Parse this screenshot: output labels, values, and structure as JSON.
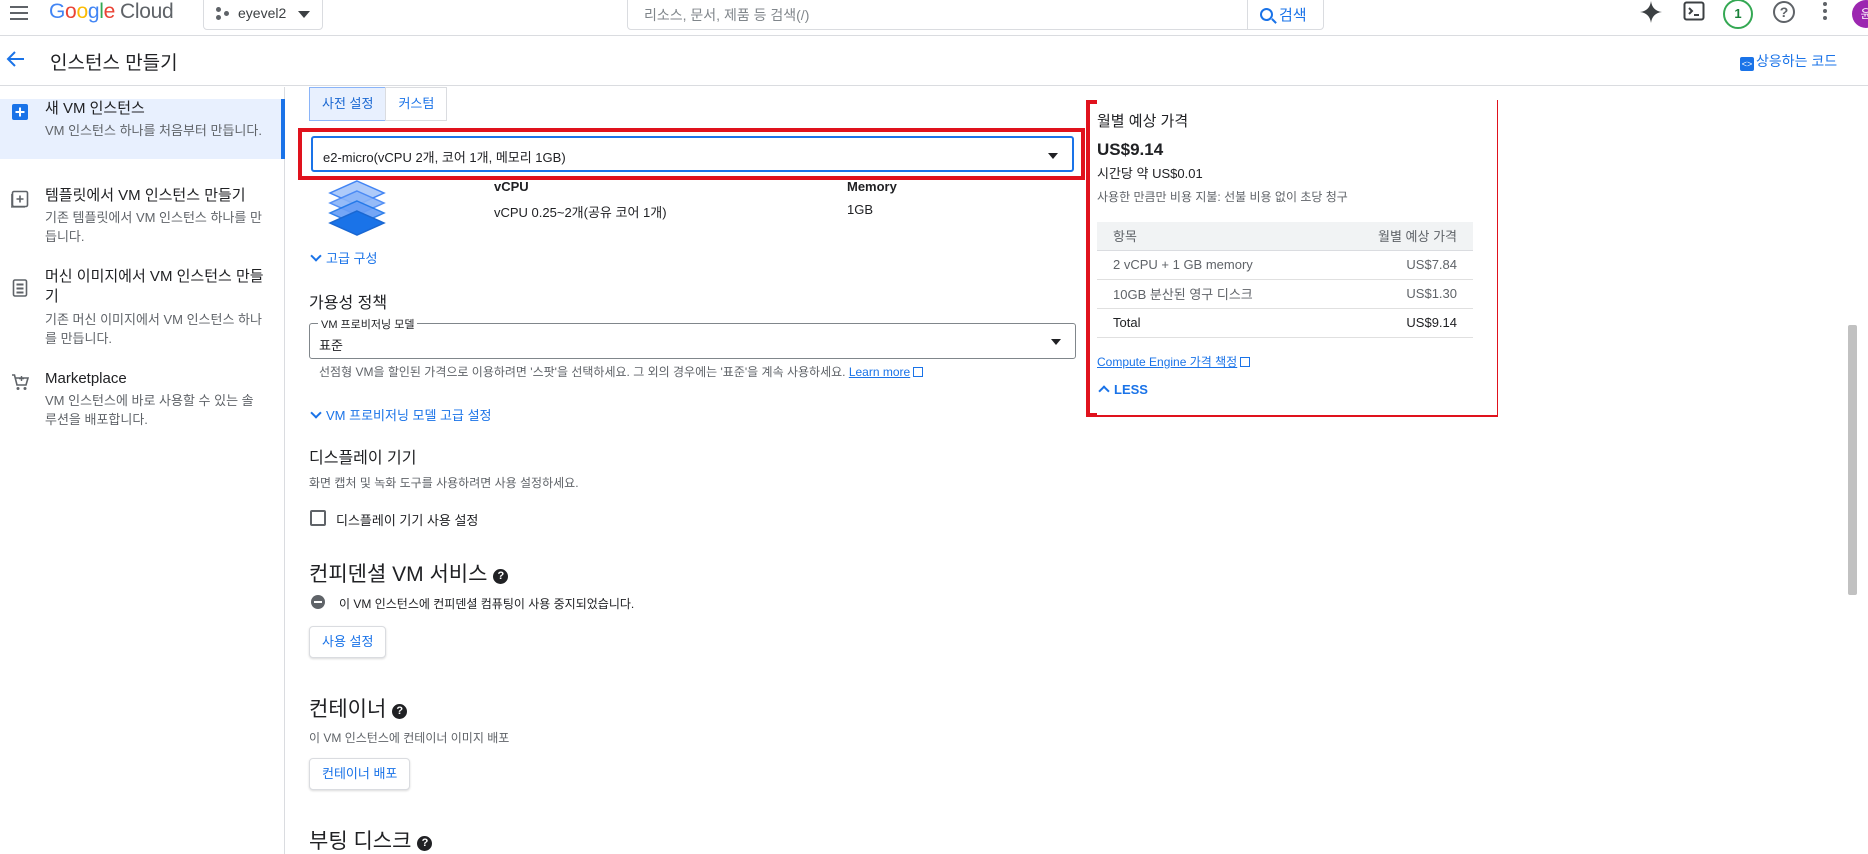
{
  "topbar": {
    "logo": {
      "g": "G",
      "o1": "o",
      "o2": "o",
      "g2": "g",
      "l": "l",
      "e": "e",
      "cloud": "Cloud"
    },
    "project": "eyevel2",
    "search_placeholder": "리소스, 문서, 제품 등 검색(/)",
    "search_button": "검색",
    "notification_count": "1",
    "avatar_initial": "윤"
  },
  "header": {
    "title": "인스턴스 만들기",
    "code_link": "상응하는 코드"
  },
  "sidebar": {
    "items": [
      {
        "label": "새 VM 인스턴스",
        "desc": "VM 인스턴스 하나를 처음부터 만듭니다."
      },
      {
        "label": "템플릿에서 VM 인스턴스 만들기",
        "desc": "기존 템플릿에서 VM 인스턴스 하나를 만듭니다."
      },
      {
        "label": "머신 이미지에서 VM 인스턴스 만들기",
        "desc": "기존 머신 이미지에서 VM 인스턴스 하나를 만듭니다."
      },
      {
        "label": "Marketplace",
        "desc": "VM 인스턴스에 바로 사용할 수 있는 솔루션을 배포합니다."
      }
    ]
  },
  "main": {
    "tabs": [
      "사전 설정",
      "커스텀"
    ],
    "machine_type": "e2-micro(vCPU 2개, 코어 1개, 메모리 1GB)",
    "specs": {
      "vcpu_header": "vCPU",
      "vcpu_value": "vCPU 0.25~2개(공유 코어 1개)",
      "memory_header": "Memory",
      "memory_value": "1GB"
    },
    "advanced_config": "고급 구성",
    "availability": {
      "title": "가용성 정책",
      "field_label": "VM 프로비저닝 모델",
      "field_value": "표준",
      "hint": "선점형 VM을 할인된 가격으로 이용하려면 '스팟'을 선택하세요. 그 외의 경우에는 '표준'을 계속 사용하세요.",
      "learn_more": "Learn more",
      "advanced_link": "VM 프로비저닝 모델 고급 설정"
    },
    "display": {
      "title": "디스플레이 기기",
      "hint": "화면 캡처 및 녹화 도구를 사용하려면 사용 설정하세요.",
      "checkbox_label": "디스플레이 기기 사용 설정"
    },
    "confidential": {
      "title": "컨피덴셜 VM 서비스",
      "status": "이 VM 인스턴스에 컨피덴셜 컴퓨팅이 사용 중지되었습니다.",
      "button": "사용 설정"
    },
    "container": {
      "title": "컨테이너",
      "hint": "이 VM 인스턴스에 컨테이너 이미지 배포",
      "button": "컨테이너 배포"
    },
    "boot_disk": {
      "title": "부팅 디스크"
    }
  },
  "price_panel": {
    "title": "월별 예상 가격",
    "monthly": "US$9.14",
    "hourly_prefix": "시간당 약",
    "hourly": "US$0.01",
    "note": "사용한 만큼만 비용 지불: 선불 비용 없이 초당 청구",
    "table_headers": [
      "항목",
      "월별 예상 가격"
    ],
    "rows": [
      [
        "2 vCPU + 1 GB memory",
        "US$7.84"
      ],
      [
        "10GB 분산된 영구 디스크",
        "US$1.30"
      ],
      [
        "Total",
        "US$9.14"
      ]
    ],
    "pricing_link": "Compute Engine 가격 책정",
    "less": "LESS"
  },
  "colors": {
    "accent": "#1a73e8",
    "highlight_red": "#e0121d",
    "selected_bg": "#e8f0fe"
  }
}
